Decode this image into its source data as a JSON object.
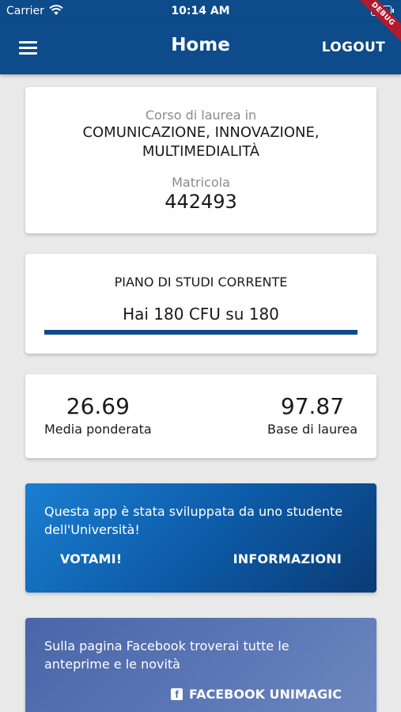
{
  "status_bar": {
    "carrier": "Carrier",
    "time": "10:14 AM"
  },
  "app_bar": {
    "title": "Home",
    "logout_label": "LOGOUT",
    "debug_label": "DEBUG"
  },
  "course_card": {
    "course_label": "Corso di laurea in",
    "course_name": "COMUNICAZIONE, INNOVAZIONE, MULTIMEDIALITÀ",
    "matricola_label": "Matricola",
    "matricola_value": "442493"
  },
  "study_plan_card": {
    "title": "PIANO DI STUDI CORRENTE",
    "cfu_text": "Hai 180 CFU su 180",
    "progress": 1.0
  },
  "grades_card": {
    "weighted_average_value": "26.69",
    "weighted_average_label": "Media ponderata",
    "graduation_base_value": "97.87",
    "graduation_base_label": "Base di laurea"
  },
  "promo_card": {
    "text": "Questa app è stata sviluppata da uno studente dell'Università!",
    "vote_label": "VOTAMI!",
    "info_label": "INFORMAZIONI"
  },
  "facebook_card": {
    "text": "Sulla pagina Facebook troverai tutte le anteprime e le novità",
    "button_label": "FACEBOOK UNIMAGIC",
    "icon": "facebook-icon"
  },
  "colors": {
    "primary": "#0d4b8a",
    "promo_gradient_start": "#1b7ed1",
    "promo_gradient_end": "#0a3b74",
    "facebook": "#4a66a8"
  }
}
